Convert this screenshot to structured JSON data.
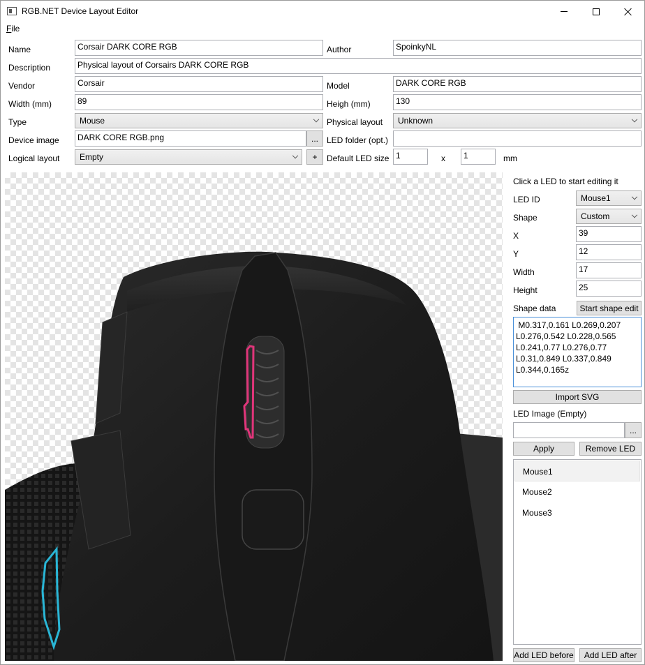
{
  "window": {
    "title": "RGB.NET Device Layout Editor",
    "icon": "app-window-icon"
  },
  "menu": {
    "file_label": "F",
    "file_label_rest": "ile"
  },
  "form": {
    "name": {
      "label": "Name",
      "value": "Corsair DARK CORE RGB"
    },
    "author": {
      "label": "Author",
      "value": "SpoinkyNL"
    },
    "description": {
      "label": "Description",
      "value": "Physical layout of Corsairs DARK CORE RGB"
    },
    "vendor": {
      "label": "Vendor",
      "value": "Corsair"
    },
    "model": {
      "label": "Model",
      "value": "DARK CORE RGB"
    },
    "width": {
      "label": "Width (mm)",
      "value": "89"
    },
    "height": {
      "label": "Heigh (mm)",
      "value": "130"
    },
    "type": {
      "label": "Type",
      "value": "Mouse"
    },
    "physical_layout": {
      "label": "Physical layout",
      "value": "Unknown"
    },
    "device_image": {
      "label": "Device image",
      "value": "DARK CORE RGB.png",
      "browse": "..."
    },
    "led_folder": {
      "label": "LED folder (opt.)",
      "value": ""
    },
    "logical_layout": {
      "label": "Logical layout",
      "value": "Empty",
      "add": "+"
    },
    "default_led_size": {
      "label": "Default LED size",
      "x": "1",
      "sep": "x",
      "y": "1",
      "unit": "mm"
    }
  },
  "led_panel": {
    "hint": "Click a LED to start editing it",
    "led_id": {
      "label": "LED ID",
      "value": "Mouse1"
    },
    "shape": {
      "label": "Shape",
      "value": "Custom"
    },
    "x": {
      "label": "X",
      "value": "39"
    },
    "y": {
      "label": "Y",
      "value": "12"
    },
    "width": {
      "label": "Width",
      "value": "17"
    },
    "height": {
      "label": "Height",
      "value": "25"
    },
    "shape_data": {
      "label": "Shape data",
      "button": "Start shape edit",
      "value": " M0.317,0.161 L0.269,0.207\nL0.276,0.542 L0.228,0.565\nL0.241,0.77 L0.276,0.77\nL0.31,0.849 L0.337,0.849\nL0.344,0.165z"
    },
    "import_svg": "Import SVG",
    "led_image": {
      "label": "LED Image (Empty)",
      "value": "",
      "browse": "..."
    },
    "apply": "Apply",
    "remove_led": "Remove LED",
    "leds": [
      "Mouse1",
      "Mouse2",
      "Mouse3"
    ],
    "selected_led": "Mouse1",
    "add_before": "Add LED before",
    "add_after": "Add LED after"
  },
  "colors": {
    "led_mouse1": "#e0357a",
    "led_mouse2": "#29b6d6",
    "mouse_body": "#1e1e1e"
  }
}
